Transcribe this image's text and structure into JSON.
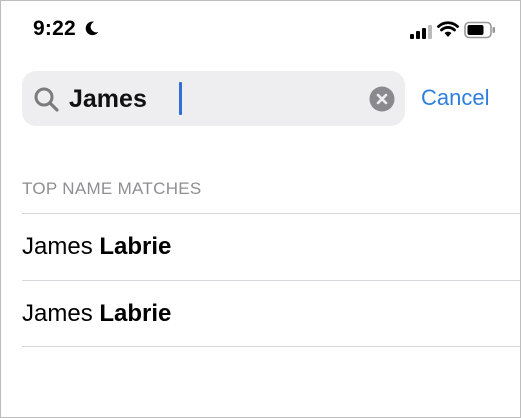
{
  "status": {
    "time": "9:22",
    "icons": [
      "moon-icon",
      "cellular-signal-icon",
      "wifi-icon",
      "battery-icon"
    ]
  },
  "search": {
    "query": "James ",
    "clear_icon": "clear-circle-icon",
    "cancel_label": "Cancel"
  },
  "results": {
    "section_header": "TOP NAME MATCHES",
    "items": [
      {
        "first": "James",
        "last": "Labrie"
      },
      {
        "first": "James",
        "last": "Labrie"
      }
    ]
  },
  "colors": {
    "accent": "#2f7fe0",
    "search_bg": "#eeeef0",
    "header_gray": "#8e8e93"
  }
}
